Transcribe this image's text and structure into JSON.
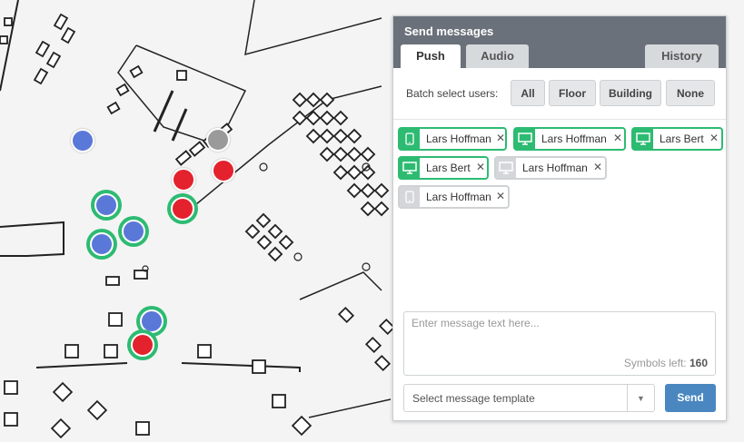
{
  "panel": {
    "title": "Send messages",
    "tabs": [
      {
        "label": "Push",
        "active": true
      },
      {
        "label": "Audio",
        "active": false
      },
      {
        "label": "History",
        "active": false
      }
    ],
    "batch_label": "Batch select users:",
    "batch_buttons": [
      "All",
      "Floor",
      "Building",
      "None"
    ],
    "recipients": [
      {
        "name": "Lars Hoffman",
        "device": "phone-icon",
        "status": "online"
      },
      {
        "name": "Lars Hoffman",
        "device": "monitor-icon",
        "status": "online"
      },
      {
        "name": "Lars Bert",
        "device": "monitor-icon",
        "status": "online"
      },
      {
        "name": "Lars Bert",
        "device": "monitor-icon",
        "status": "online"
      },
      {
        "name": "Lars Hoffman",
        "device": "monitor-icon",
        "status": "offline"
      },
      {
        "name": "Lars Hoffman",
        "device": "phone-icon",
        "status": "offline"
      }
    ],
    "message_placeholder": "Enter message text here...",
    "symbols_label": "Symbols left:",
    "symbols_left": "160",
    "template_placeholder": "Select message template",
    "send_label": "Send"
  },
  "colors": {
    "header": "#6b717a",
    "online": "#2dbb72",
    "offline": "#d4d6d9",
    "send": "#4a87c0",
    "marker_blue": "#5a78d8",
    "marker_red": "#e3222e",
    "marker_gray": "#9a9a9a"
  },
  "map_markers": [
    {
      "color": "blue",
      "ring": false
    },
    {
      "color": "gray",
      "ring": false
    },
    {
      "color": "red",
      "ring": false
    },
    {
      "color": "red",
      "ring": false
    },
    {
      "color": "blue",
      "ring": true
    },
    {
      "color": "red",
      "ring": true
    },
    {
      "color": "blue",
      "ring": true
    },
    {
      "color": "blue",
      "ring": true
    },
    {
      "color": "blue",
      "ring": true
    },
    {
      "color": "red",
      "ring": true
    }
  ]
}
